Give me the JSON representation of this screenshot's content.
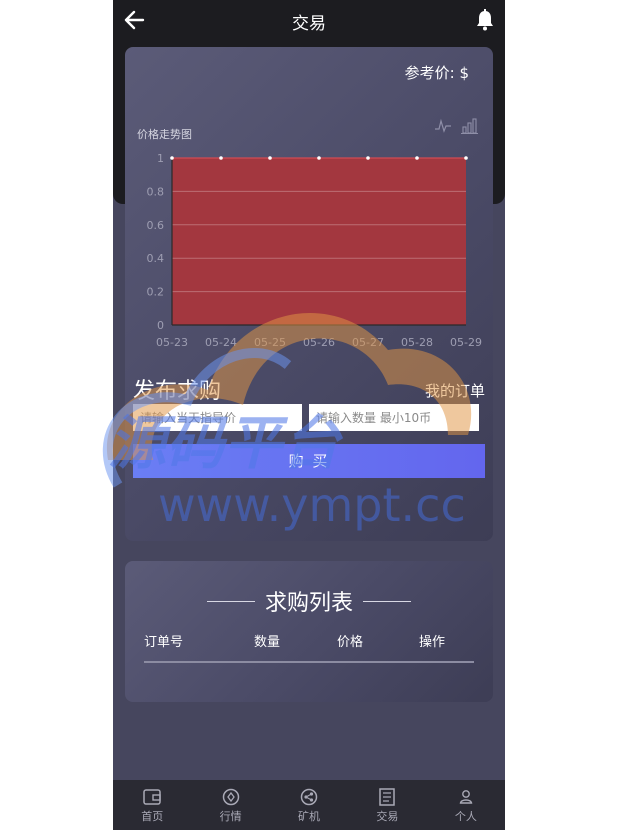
{
  "header": {
    "title": "交易"
  },
  "price_card": {
    "ref_price_label": "参考价:",
    "ref_price_unit": "$",
    "chart_label": "价格走势图"
  },
  "chart_data": {
    "type": "area",
    "title": "",
    "x": [
      "05-23",
      "05-24",
      "05-25",
      "05-26",
      "05-27",
      "05-28",
      "05-29"
    ],
    "series": [
      {
        "values": [
          1,
          1,
          1,
          1,
          1,
          1,
          1
        ],
        "color": "#a3373f"
      }
    ],
    "ylim": [
      0,
      1
    ],
    "yticks": [
      "0",
      "0.2",
      "0.4",
      "0.6",
      "0.8",
      "1"
    ],
    "grid": true
  },
  "order_form": {
    "publish_title": "发布求购",
    "my_orders": "我的订单",
    "price_placeholder": "请输入当天指导价",
    "qty_placeholder": "请输入数量 最小10币",
    "buy_label": "购 买"
  },
  "list": {
    "title": "求购列表",
    "columns": [
      "订单号",
      "数量",
      "价格",
      "操作"
    ]
  },
  "tabbar": {
    "items": [
      {
        "label": "首页",
        "icon": "wallet-icon"
      },
      {
        "label": "行情",
        "icon": "compass-icon"
      },
      {
        "label": "矿机",
        "icon": "share-nodes-icon"
      },
      {
        "label": "交易",
        "icon": "document-icon"
      },
      {
        "label": "个人",
        "icon": "person-icon"
      }
    ]
  },
  "watermark": {
    "text": "源码平台",
    "url": "www.ympt.cc"
  },
  "colors": {
    "bg": "#46465e",
    "header": "#1c1c20",
    "button": "#6a7ef4",
    "chart_fill": "#a3373f"
  }
}
